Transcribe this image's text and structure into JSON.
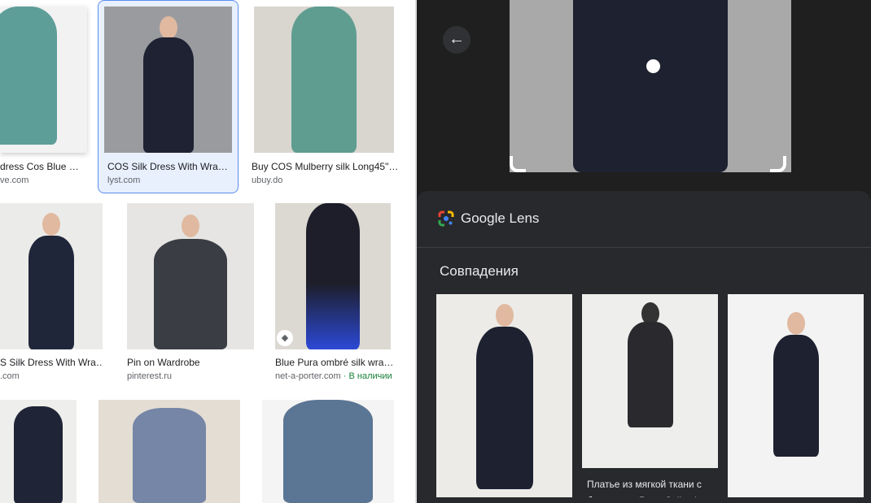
{
  "results": [
    {
      "title": "dress Cos Blue …",
      "source": "ve.com"
    },
    {
      "title": "COS Silk Dress With Wra…",
      "source": "lyst.com",
      "selected": true
    },
    {
      "title": "Buy COS Mulberry silk Long45\"…",
      "source": "ubuy.do"
    },
    {
      "title": "S Silk Dress With Wra…",
      "source": ".com"
    },
    {
      "title": "Pin on Wardrobe",
      "source": "pinterest.ru"
    },
    {
      "title": "Blue Pura ombré silk wra…",
      "source": "net-a-porter.com",
      "availability": " · В наличии"
    }
  ],
  "lens": {
    "back_icon": "arrow-left-icon",
    "brand": "Google Lens",
    "section_title": "Совпадения",
    "matches": [
      {
        "title": ""
      },
      {
        "title": "Платье из мягкой ткани с бусинами - Party Collectio"
      },
      {
        "title": ""
      }
    ]
  },
  "colors": {
    "selected_border": "#5a8ef0",
    "panel": "#28292c",
    "in_stock": "#188038"
  }
}
